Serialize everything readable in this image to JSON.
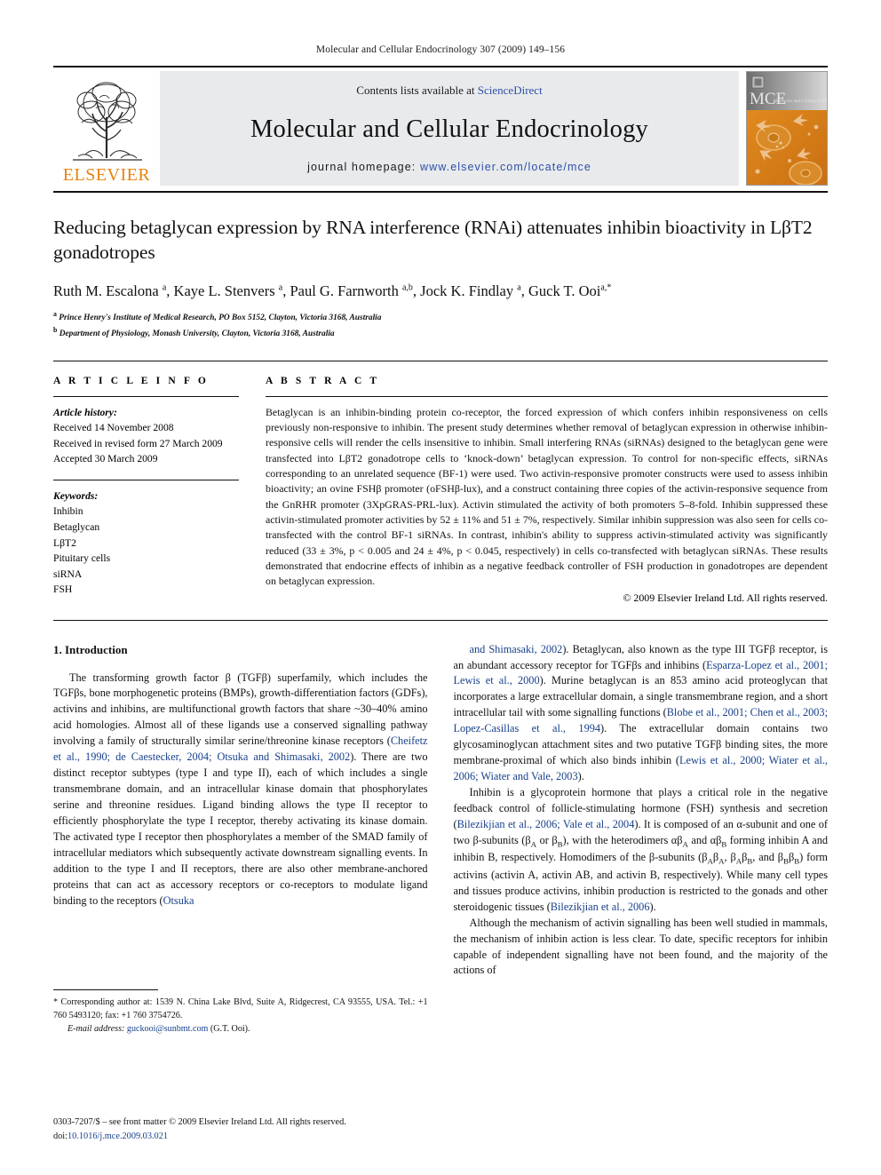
{
  "running_head": "Molecular and Cellular Endocrinology 307 (2009) 149–156",
  "masthead": {
    "contents_prefix": "Contents lists available at ",
    "sciencedirect": "ScienceDirect",
    "journal_title": "Molecular and Cellular Endocrinology",
    "homepage_prefix": "journal homepage: ",
    "homepage_url": "www.elsevier.com/locate/mce",
    "publisher_wordmark": "ELSEVIER",
    "cover_title": "MCE",
    "cover_subtitle": "Molecular and Cellular Endocrinology",
    "link_color": "#2b50a8",
    "elsevier_orange": "#E8820C",
    "panel_bg": "#e9eaec"
  },
  "article": {
    "title": "Reducing betaglycan expression by RNA interference (RNAi) attenuates inhibin bioactivity in LβT2 gonadotropes",
    "authors_html": "Ruth M. Escalona <sup>a</sup>, Kaye L. Stenvers <sup>a</sup>, Paul G. Farnworth <sup>a,b</sup>, Jock K. Findlay <sup>a</sup>, Guck T. Ooi<sup>a,</sup><sup>*</sup>",
    "affiliations": [
      "Prince Henry's Institute of Medical Research, PO Box 5152, Clayton, Victoria 3168, Australia",
      "Department of Physiology, Monash University, Clayton, Victoria 3168, Australia"
    ],
    "affiliation_marks": [
      "a",
      "b"
    ]
  },
  "article_info": {
    "heading": "A R T I C L E    I N F O",
    "history_title": "Article history:",
    "history": [
      "Received 14 November 2008",
      "Received in revised form 27 March 2009",
      "Accepted 30 March 2009"
    ],
    "keywords_title": "Keywords:",
    "keywords": [
      "Inhibin",
      "Betaglycan",
      "LβT2",
      "Pituitary cells",
      "siRNA",
      "FSH"
    ]
  },
  "abstract": {
    "heading": "A B S T R A C T",
    "text": "Betaglycan is an inhibin-binding protein co-receptor, the forced expression of which confers inhibin responsiveness on cells previously non-responsive to inhibin. The present study determines whether removal of betaglycan expression in otherwise inhibin-responsive cells will render the cells insensitive to inhibin. Small interfering RNAs (siRNAs) designed to the betaglycan gene were transfected into LβT2 gonadotrope cells to ‘knock-down’ betaglycan expression. To control for non-specific effects, siRNAs corresponding to an unrelated sequence (BF-1) were used. Two activin-responsive promoter constructs were used to assess inhibin bioactivity; an ovine FSHβ promoter (oFSHβ-lux), and a construct containing three copies of the activin-responsive sequence from the GnRHR promoter (3XpGRAS-PRL-lux). Activin stimulated the activity of both promoters 5–8-fold. Inhibin suppressed these activin-stimulated promoter activities by 52 ± 11% and 51 ± 7%, respectively. Similar inhibin suppression was also seen for cells co-transfected with the control BF-1 siRNAs. In contrast, inhibin's ability to suppress activin-stimulated activity was significantly reduced (33 ± 3%, p < 0.005 and 24 ± 4%, p < 0.045, respectively) in cells co-transfected with betaglycan siRNAs. These results demonstrated that endocrine effects of inhibin as a negative feedback controller of FSH production in gonadotropes are dependent on betaglycan expression.",
    "copyright": "© 2009 Elsevier Ireland Ltd. All rights reserved."
  },
  "introduction": {
    "heading": "1.  Introduction",
    "left_para1_pre": "The transforming growth factor β (TGFβ) superfamily, which includes the TGFβs, bone morphogenetic proteins (BMPs), growth-differentiation factors (GDFs), activins and inhibins, are multifunctional growth factors that share ~30–40% amino acid homologies. Almost all of these ligands use a conserved signalling pathway involving a family of structurally similar serine/threonine kinase receptors (",
    "left_cite1": "Cheifetz et al., 1990; de Caestecker, 2004; Otsuka and Shimasaki, 2002",
    "left_para1_mid": "). There are two distinct receptor subtypes (type I and type II), each of which includes a single transmembrane domain, and an intracellular kinase domain that phosphorylates serine and threonine residues. Ligand binding allows the type II receptor to efficiently phosphorylate the type I receptor, thereby activating its kinase domain. The activated type I receptor then phosphorylates a member of the SMAD family of intracellular mediators which subsequently activate downstream signalling events. In addition to the type I and II receptors, there are also other membrane-anchored proteins that can act as accessory receptors or co-receptors to modulate ligand binding to the receptors (",
    "left_cite2": "Otsuka",
    "right_cite_cont": "and Shimasaki, 2002",
    "right_para1_a": "). Betaglycan, also known as the type III TGFβ receptor, is an abundant accessory receptor for TGFβs and inhibins (",
    "right_cite1": "Esparza-Lopez et al., 2001; Lewis et al., 2000",
    "right_para1_b": "). Murine betaglycan is an 853 amino acid proteoglycan that incorporates a large extracellular domain, a single transmembrane region, and a short intracellular tail with some signalling functions (",
    "right_cite2": "Blobe et al., 2001; Chen et al., 2003; Lopez-Casillas et al., 1994",
    "right_para1_c": "). The extracellular domain contains two glycosaminoglycan attachment sites and two putative TGFβ binding sites, the more membrane-proximal of which also binds inhibin (",
    "right_cite3": "Lewis et al., 2000; Wiater et al., 2006; Wiater and Vale, 2003",
    "right_para1_d": ").",
    "right_para2_a": "Inhibin is a glycoprotein hormone that plays a critical role in the negative feedback control of follicle-stimulating hormone (FSH) synthesis and secretion (",
    "right_cite4": "Bilezikjian et al., 2006; Vale et al., 2004",
    "right_para2_b": "). It is composed of an α-subunit and one of two β-subunits (β<sub>A</sub> or β<sub>B</sub>), with the heterodimers αβ<sub>A</sub> and αβ<sub>B</sub> forming inhibin A and inhibin B, respectively. Homodimers of the β-subunits (β<sub>A</sub>β<sub>A</sub>, β<sub>A</sub>β<sub>B</sub>, and β<sub>B</sub>β<sub>B</sub>) form activins (activin A, activin AB, and activin B, respectively). While many cell types and tissues produce activins, inhibin production is restricted to the gonads and other steroidogenic tissues (",
    "right_cite5": "Bilezikjian et al., 2006",
    "right_para2_c": ").",
    "right_para3": "Although the mechanism of activin signalling has been well studied in mammals, the mechanism of inhibin action is less clear. To date, specific receptors for inhibin capable of independent signalling have not been found, and the majority of the actions of",
    "citation_color": "#17408B"
  },
  "footnotes": {
    "corresponding_marker": "*",
    "corresponding_text": "Corresponding author at: 1539 N. China Lake Blvd, Suite A, Ridgecrest, CA 93555, USA. Tel.: +1 760 5493120; fax: +1 760 3754726.",
    "email_label": "E-mail address:",
    "email": "guckooi@sunbmt.com",
    "email_suffix": "(G.T. Ooi).",
    "frontmatter": "0303-7207/$ – see front matter © 2009 Elsevier Ireland Ltd. All rights reserved.",
    "doi_label": "doi:",
    "doi": "10.1016/j.mce.2009.03.021"
  }
}
